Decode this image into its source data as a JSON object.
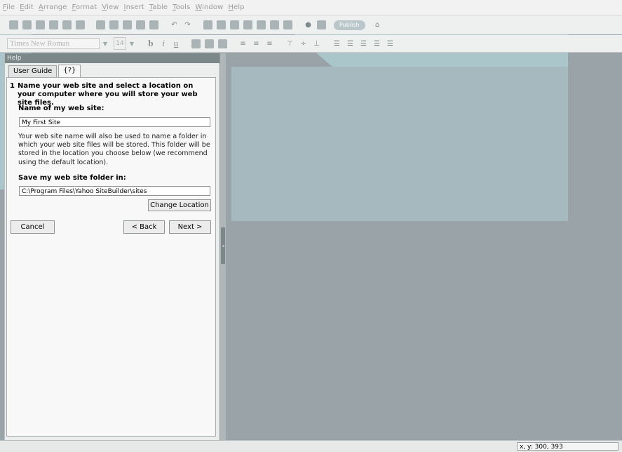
{
  "menu": [
    {
      "label": "File",
      "key": "F"
    },
    {
      "label": "Edit",
      "key": "E"
    },
    {
      "label": "Arrange",
      "key": "A"
    },
    {
      "label": "Format",
      "key": "F"
    },
    {
      "label": "View",
      "key": "V"
    },
    {
      "label": "Insert",
      "key": "I"
    },
    {
      "label": "Table",
      "key": "T"
    },
    {
      "label": "Tools",
      "key": "T"
    },
    {
      "label": "Window",
      "key": "W"
    },
    {
      "label": "Help",
      "key": "H"
    }
  ],
  "toolbar": {
    "publish_label": "Publish",
    "font_name": "Times New Roman",
    "font_size": "14",
    "bold": "b",
    "italic": "i",
    "underline": "u"
  },
  "panel": {
    "title": "Help",
    "tabs": [
      "User Guide",
      "{?}"
    ],
    "step_number": "1",
    "step_text": "Name your web site and select a location on your computer where you will store your web site files.",
    "site_name_label": "Name of my web site:",
    "site_name_value": "My First Site",
    "description": "Your web site name will also be used to name a folder in which your web site files will be stored. This folder will be stored in the location you choose below (we recommend using the default location).",
    "folder_label": "Save my web site folder in:",
    "folder_value": "C:\\Program Files\\Yahoo SiteBuilder\\sites",
    "change_location": "Change Location",
    "cancel": "Cancel",
    "back": "< Back",
    "next": "Next >"
  },
  "status": {
    "coords": "x, y: 300, 393"
  }
}
